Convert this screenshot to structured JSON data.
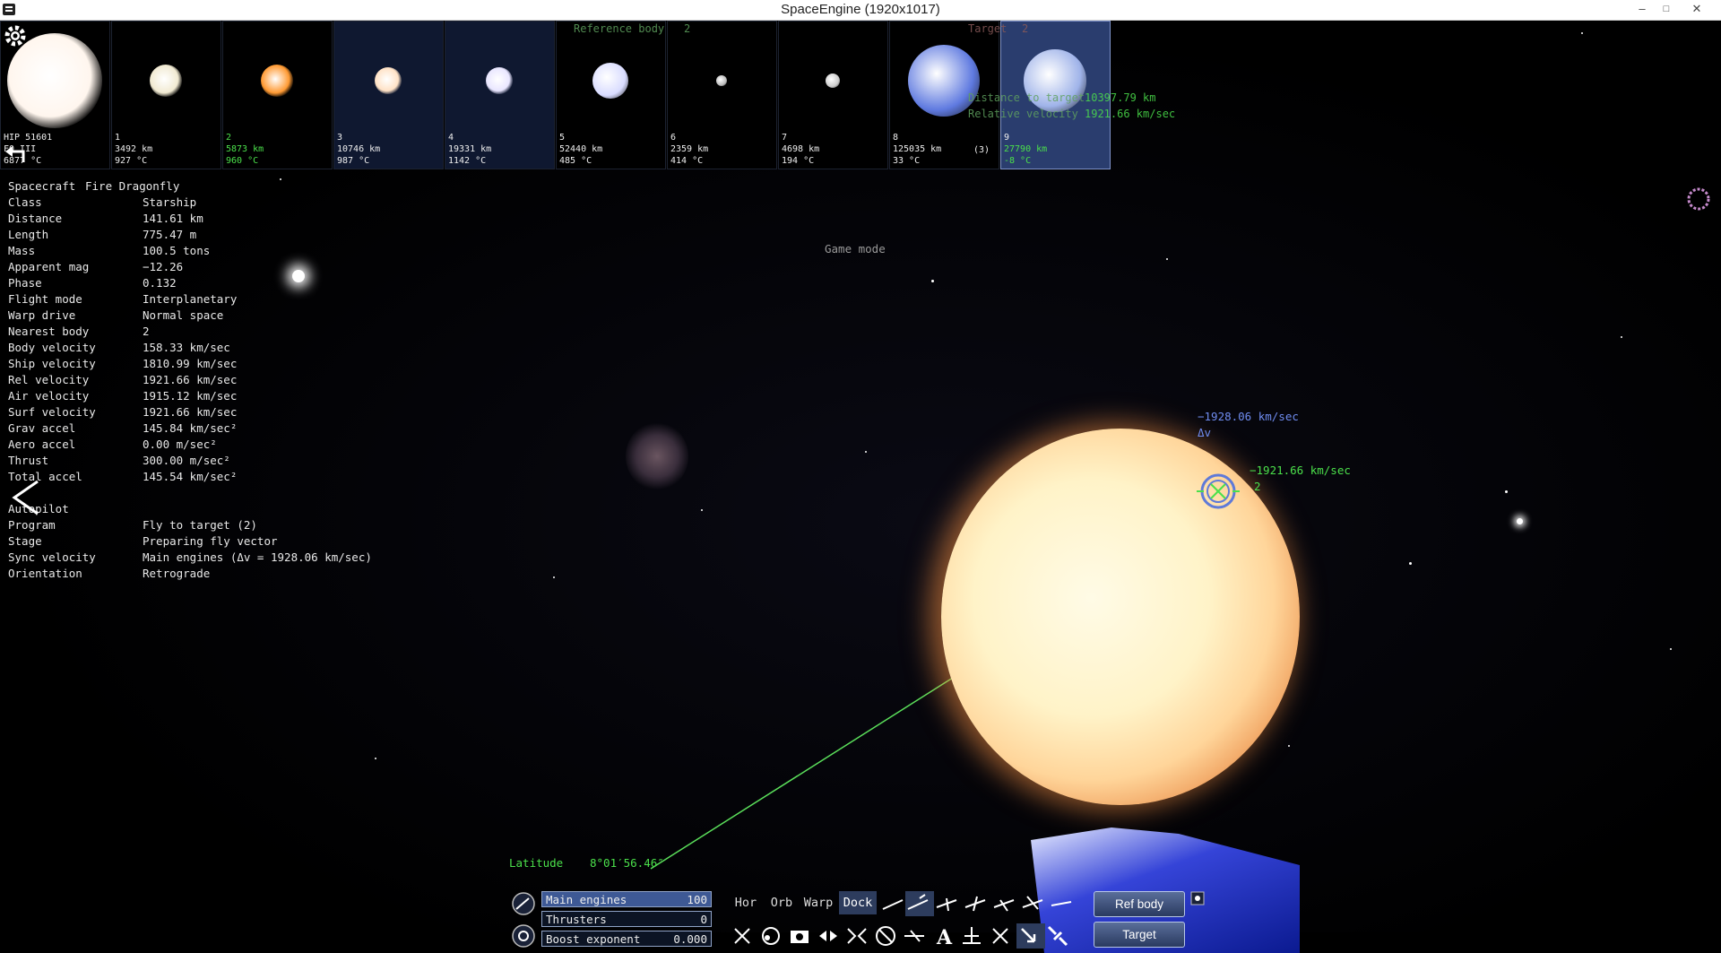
{
  "window": {
    "title": "SpaceEngine (1920x1017)",
    "minimize": "–",
    "restore": "□",
    "close": "✕"
  },
  "strip": {
    "overlay_ref_label": "Reference body",
    "overlay_ref_value": "2",
    "overlay_target_label": "Target",
    "overlay_target_value": "2",
    "overlay_dist_label": "Distance to target",
    "overlay_dist_value": "10397.79 km",
    "overlay_vel_label": "Relative velocity",
    "overlay_vel_value": "1921.66 km/sec",
    "tiles": [
      {
        "name": "HIP 51601",
        "line2": "F0 III",
        "line3": "6877 °C",
        "color": "#fff6ee",
        "green": false
      },
      {
        "name": "1",
        "line2": "3492 km",
        "line3": "927 °C",
        "color": "#f1ead2",
        "green": false
      },
      {
        "name": "2",
        "line2": "5873 km",
        "line3": "960 °C",
        "color": "#ff9a33",
        "green": true
      },
      {
        "name": "3",
        "line2": "10746 km",
        "line3": "987 °C",
        "color": "#ffe2c6",
        "green": false
      },
      {
        "name": "4",
        "line2": "19331 km",
        "line3": "1142 °C",
        "color": "#e9e6ff",
        "green": false
      },
      {
        "name": "5",
        "line2": "52440 km",
        "line3": "485 °C",
        "color": "#d9dcff",
        "green": false
      },
      {
        "name": "6",
        "line2": "2359 km",
        "line3": "414 °C",
        "color": "#bbbbbb",
        "green": false
      },
      {
        "name": "7",
        "line2": "4698 km",
        "line3": "194 °C",
        "color": "#cccccc",
        "green": false
      },
      {
        "name": "8",
        "line2": "125035 km",
        "line3": "33 °C",
        "color": "#5f7ae0",
        "green": false,
        "count": "(3)"
      },
      {
        "name": "9",
        "line2": "27790 km",
        "line3": "-8 °C",
        "color": "#9fb3e9",
        "green": true
      }
    ]
  },
  "info": {
    "rows": [
      {
        "k": "Spacecraft",
        "v": "Fire Dragonfly"
      },
      {
        "k": "Class",
        "v": "Starship"
      },
      {
        "k": "Distance",
        "v": "141.61 km"
      },
      {
        "k": "Length",
        "v": "775.47 m"
      },
      {
        "k": "Mass",
        "v": "100.5 tons"
      },
      {
        "k": "Apparent mag",
        "v": "−12.26"
      },
      {
        "k": "Phase",
        "v": "0.132"
      },
      {
        "k": "Flight mode",
        "v": "Interplanetary"
      },
      {
        "k": "Warp drive",
        "v": "Normal space"
      },
      {
        "k": "Nearest body",
        "v": "2"
      },
      {
        "k": "Body velocity",
        "v": "158.33 km/sec"
      },
      {
        "k": "Ship velocity",
        "v": "1810.99 km/sec"
      },
      {
        "k": "Rel velocity",
        "v": "1921.66 km/sec"
      },
      {
        "k": "Air velocity",
        "v": "1915.12 km/sec"
      },
      {
        "k": "Surf velocity",
        "v": "1921.66 km/sec"
      },
      {
        "k": "Grav accel",
        "v": "145.84 km/sec²"
      },
      {
        "k": "Aero accel",
        "v": "0.00 m/sec²"
      },
      {
        "k": "Thrust",
        "v": "300.00 m/sec²"
      },
      {
        "k": "Total accel",
        "v": "145.54 km/sec²"
      },
      {
        "k": "",
        "v": ""
      },
      {
        "k": "Autopilot",
        "v": ""
      },
      {
        "k": "Program",
        "v": "Fly to target (2)"
      },
      {
        "k": "Stage",
        "v": "Preparing fly vector"
      },
      {
        "k": "Sync velocity",
        "v": "Main engines (Δv = 1928.06 km/sec)"
      },
      {
        "k": "Orientation",
        "v": "Retrograde"
      }
    ]
  },
  "game_mode": "Game mode",
  "markers": {
    "dv_value": "−1928.06 km/sec",
    "dv_label": "Δv",
    "rel_value": "−1921.66 km/sec",
    "target_name": "2"
  },
  "latitude": {
    "label": "Latitude",
    "value": "8°01′56.46″"
  },
  "controls": {
    "main_engines": {
      "label": "Main engines",
      "value": "100",
      "fill": 1.0
    },
    "thrusters": {
      "label": "Thrusters",
      "value": "0",
      "fill": 0.0
    },
    "boost": {
      "label": "Boost exponent",
      "value": "0.000",
      "fill": 0.0
    },
    "modes": [
      "Hor",
      "Orb",
      "Warp",
      "Dock"
    ],
    "active_mode": "Dock",
    "ref_body": "Ref body",
    "target": "Target"
  }
}
